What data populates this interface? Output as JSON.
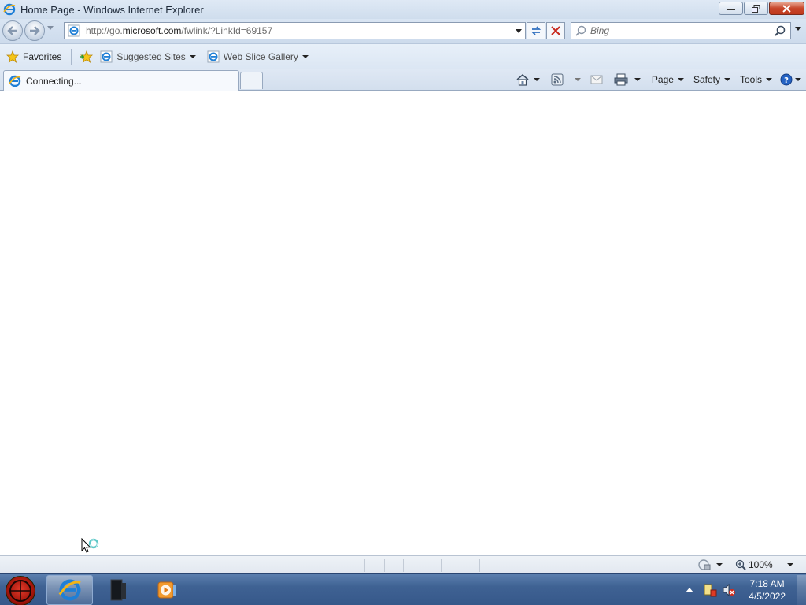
{
  "window": {
    "title": "Home Page - Windows Internet Explorer"
  },
  "address_bar": {
    "url_prefix": "http://go.",
    "url_domain": "microsoft.com",
    "url_suffix": "/fwlink/?LinkId=69157"
  },
  "search": {
    "placeholder": "Bing"
  },
  "favorites_bar": {
    "favorites_label": "Favorites",
    "suggested_sites_label": "Suggested Sites",
    "web_slice_gallery_label": "Web Slice Gallery"
  },
  "tabs": [
    {
      "label": "Connecting..."
    }
  ],
  "command_bar": {
    "page_label": "Page",
    "safety_label": "Safety",
    "tools_label": "Tools"
  },
  "status_bar": {
    "zoom": "100%"
  },
  "taskbar": {
    "time": "7:18 AM",
    "date": "4/5/2022"
  },
  "icons": {
    "ie": "ie-icon",
    "back": "back-arrow-icon",
    "forward": "forward-arrow-icon",
    "refresh": "refresh-icon",
    "stop": "stop-icon",
    "search": "search-icon",
    "favorites": "star-icon",
    "home": "home-icon",
    "feeds": "rss-feed-icon",
    "mail": "mail-icon",
    "print": "printer-icon",
    "help": "help-icon"
  },
  "colors": {
    "chrome": "#d9e5f3",
    "taskbar": "#3f6293",
    "close_button": "#c7462b"
  }
}
